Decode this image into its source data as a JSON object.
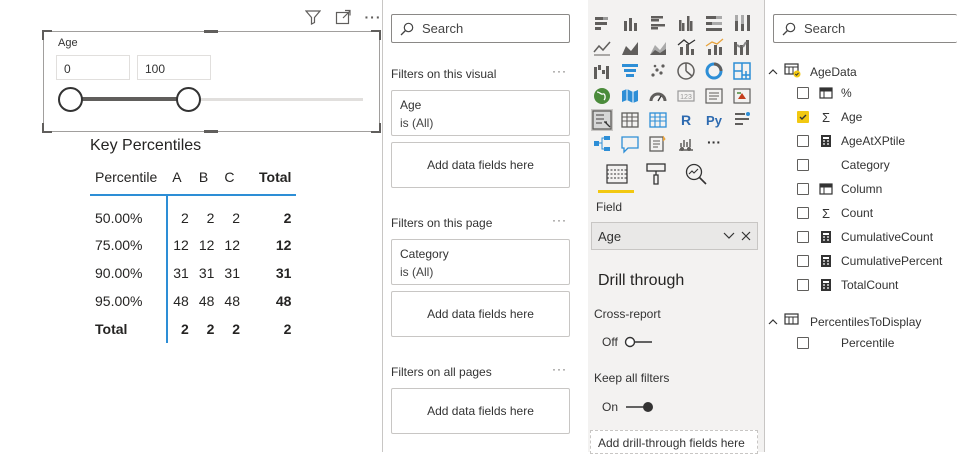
{
  "visual_header": {
    "icons": [
      "filter-icon",
      "focus-mode-icon",
      "more-options-icon"
    ],
    "more_text": "···"
  },
  "slicer": {
    "title": "Age",
    "min_value": "0",
    "max_value": "100",
    "range_fill_fraction": 0.4
  },
  "table": {
    "title": "Key Percentiles",
    "headers": [
      "Percentile",
      "A",
      "B",
      "C",
      "Total"
    ],
    "rows": [
      [
        "50.00%",
        "2",
        "2",
        "2",
        "2"
      ],
      [
        "75.00%",
        "12",
        "12",
        "12",
        "12"
      ],
      [
        "90.00%",
        "31",
        "31",
        "31",
        "31"
      ],
      [
        "95.00%",
        "48",
        "48",
        "48",
        "48"
      ]
    ],
    "total_row": [
      "Total",
      "2",
      "2",
      "2",
      "2"
    ],
    "accent_color": "#2d8ed6"
  },
  "filters": {
    "search_placeholder": "Search",
    "on_visual": {
      "heading": "Filters on this visual",
      "card_field": "Age",
      "card_value": "is (All)",
      "add_label": "Add data fields here"
    },
    "on_page": {
      "heading": "Filters on this page",
      "card_field": "Category",
      "card_value": "is (All)",
      "add_label": "Add data fields here"
    },
    "all_pages": {
      "heading": "Filters on all pages",
      "add_label": "Add data fields here"
    },
    "more_text": "···"
  },
  "visualizations": {
    "icons": [
      "stacked-bar-chart-icon",
      "stacked-column-chart-icon",
      "clustered-bar-chart-icon",
      "clustered-column-chart-icon",
      "100-stacked-bar-icon",
      "100-stacked-column-icon",
      "line-chart-icon",
      "area-chart-icon",
      "stacked-area-chart-icon",
      "line-clustered-column-icon",
      "line-stacked-column-icon",
      "ribbon-chart-icon",
      "waterfall-chart-icon",
      "funnel-chart-icon",
      "scatter-chart-icon",
      "pie-chart-icon",
      "donut-chart-icon",
      "treemap-icon",
      "map-icon",
      "filled-map-icon",
      "gauge-icon",
      "card-icon",
      "multi-row-card-icon",
      "kpi-icon",
      "slicer-icon",
      "table-icon",
      "matrix-icon",
      "r-visual-icon",
      "python-visual-icon",
      "key-influencers-icon",
      "decomposition-tree-icon",
      "qa-icon",
      "smart-narrative-icon",
      "paginated-report-icon",
      "more-visuals-icon"
    ],
    "r_label": "R",
    "py_label": "Py",
    "more_label": "···",
    "tabs": [
      "fields-tab-icon",
      "format-tab-icon",
      "analytics-tab-icon"
    ],
    "field_label": "Field",
    "field_value": "Age",
    "drill_title": "Drill through",
    "cross_report_label": "Cross-report",
    "cross_report_state": "Off",
    "keep_filters_label": "Keep all filters",
    "keep_filters_state": "On",
    "add_drill_label": "Add drill-through fields here",
    "accent_color": "#f2c811"
  },
  "fields": {
    "search_placeholder": "Search",
    "tables": [
      {
        "name": "AgeData",
        "items": [
          {
            "label": "%",
            "type": "table-icon",
            "checked": false
          },
          {
            "label": "Age",
            "type": "sigma-icon",
            "checked": true
          },
          {
            "label": "AgeAtXPtile",
            "type": "calculator-icon",
            "checked": false
          },
          {
            "label": "Category",
            "type": "none",
            "checked": false
          },
          {
            "label": "Column",
            "type": "table-icon",
            "checked": false
          },
          {
            "label": "Count",
            "type": "sigma-icon",
            "checked": false
          },
          {
            "label": "CumulativeCount",
            "type": "calculator-icon",
            "checked": false
          },
          {
            "label": "CumulativePercent",
            "type": "calculator-icon",
            "checked": false
          },
          {
            "label": "TotalCount",
            "type": "calculator-icon",
            "checked": false
          }
        ]
      },
      {
        "name": "PercentilesToDisplay",
        "items": [
          {
            "label": "Percentile",
            "type": "none",
            "checked": false
          }
        ]
      }
    ]
  }
}
